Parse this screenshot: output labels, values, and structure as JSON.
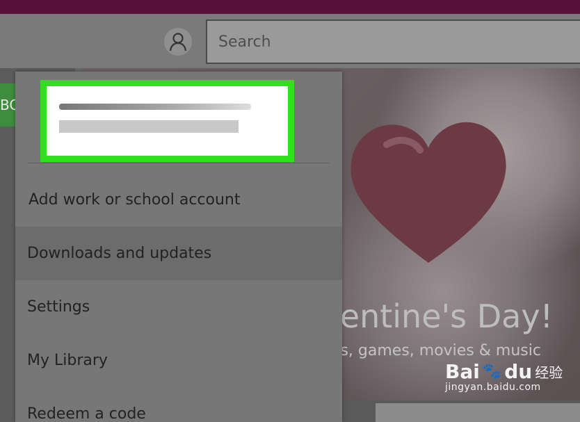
{
  "header": {
    "search_placeholder": "Search"
  },
  "menu": {
    "items": [
      {
        "label": "Add work or school account"
      },
      {
        "label": "Downloads and updates"
      },
      {
        "label": "Settings"
      },
      {
        "label": "My Library"
      },
      {
        "label": "Redeem a code"
      }
    ]
  },
  "background": {
    "hero_title": "lentine's Day!",
    "hero_subtitle": "os, games, movies & music",
    "left_chip_text": "BC"
  },
  "watermark": {
    "brand_latin_a": "Bai",
    "brand_latin_b": "du",
    "brand_cn": "经验",
    "url": "jingyan.baidu.com"
  },
  "colors": {
    "highlight_box": "#2ee11b",
    "topbar": "#57103a"
  }
}
